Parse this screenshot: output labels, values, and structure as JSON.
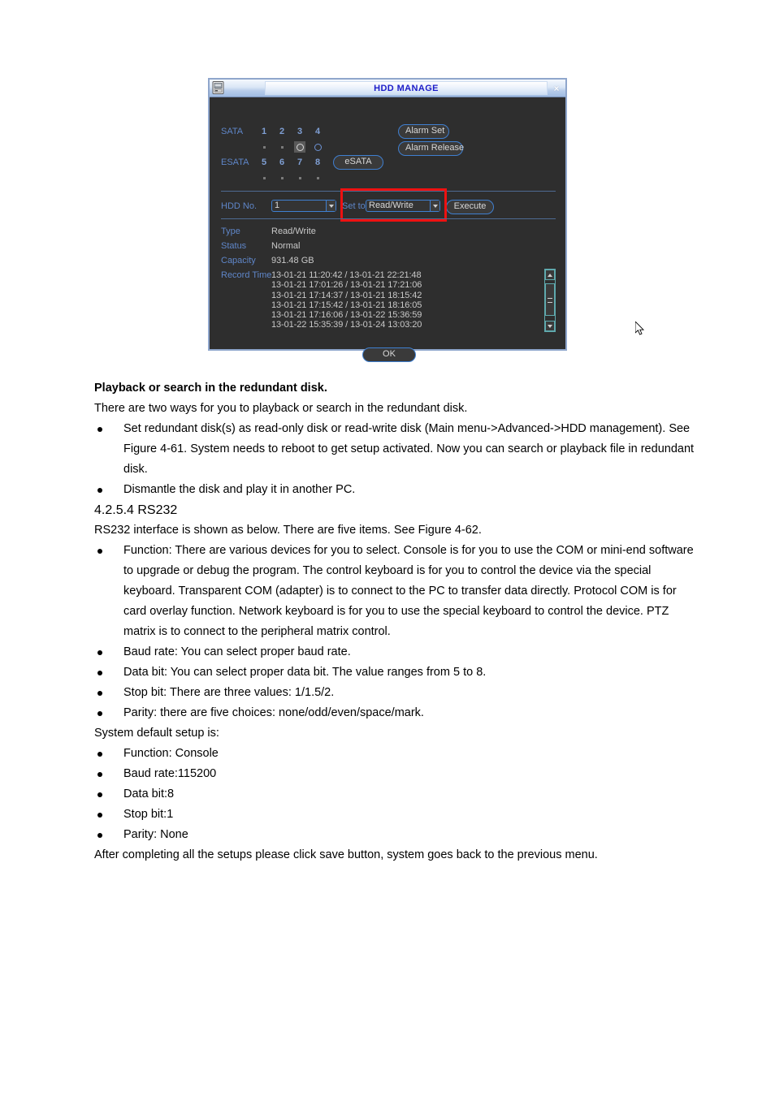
{
  "dialog": {
    "title": "HDD MANAGE",
    "icon": "hdd-icon",
    "close_label": "×",
    "sata": {
      "label": "SATA",
      "numbers": [
        "1",
        "2",
        "3",
        "4"
      ],
      "states": [
        "dot",
        "dot",
        "ring-selected",
        "ring"
      ]
    },
    "esata": {
      "label": "ESATA",
      "numbers": [
        "5",
        "6",
        "7",
        "8"
      ],
      "states": [
        "dot",
        "dot",
        "dot",
        "dot"
      ],
      "button_label": "eSATA"
    },
    "buttons": {
      "alarm_set": "Alarm Set",
      "alarm_release": "Alarm Release",
      "execute": "Execute",
      "ok": "OK"
    },
    "hdd_no": {
      "label": "HDD No.",
      "value": "1"
    },
    "set_to": {
      "label": "Set to",
      "value": "Read/Write"
    },
    "info": {
      "type_label": "Type",
      "type_value": "Read/Write",
      "status_label": "Status",
      "status_value": "Normal",
      "capacity_label": "Capacity",
      "capacity_value": "931.48 GB",
      "record_time_label": "Record Time"
    },
    "record_times": [
      "13-01-21 11:20:42 / 13-01-21 22:21:48",
      "13-01-21 17:01:26 / 13-01-21 17:21:06",
      "13-01-21 17:14:37 / 13-01-21 18:15:42",
      "13-01-21 17:15:42 / 13-01-21 18:16:05",
      "13-01-21 17:16:06 / 13-01-22 15:36:59",
      "13-01-22 15:35:39 / 13-01-24 13:03:20"
    ],
    "colors": {
      "background": "#2e2e2e",
      "border": "#8fa6cc",
      "label_blue": "#5f86c8",
      "value_gray": "#c9c9c9",
      "button_border": "#3f7fd0",
      "title_text": "#1c1cc8",
      "highlight_red": "#ee1111",
      "scrollbar_teal": "#5fa9ad"
    }
  },
  "document": {
    "section1_heading": "Playback or search in the redundant disk.",
    "section1_intro": "There are two ways for you to playback or search in the redundant disk.",
    "section1_bullets": [
      "Set redundant disk(s) as read-only disk or read-write disk (Main menu->Advanced->HDD management).  See Figure 4-61. System needs to reboot to get setup activated. Now you can search or playback file in redundant disk.",
      "Dismantle the disk and play it in another PC."
    ],
    "section2_heading": "4.2.5.4  RS232",
    "section2_intro": "RS232 interface is shown as below. There are five items. See Figure 4-62.",
    "section2_bullets": [
      "Function: There are various devices for you to select. Console is for you to use the COM or mini-end software to upgrade or debug the program. The control keyboard is for you to control the device via the special keyboard. Transparent COM (adapter) is to connect to the PC to transfer data directly. Protocol COM is for card overlay function. Network keyboard is for you to use the special keyboard to control the device. PTZ matrix is to connect to the peripheral matrix control.",
      "Baud rate: You can select proper baud rate.",
      "Data bit: You can select proper data bit. The value ranges from 5 to 8.",
      "Stop bit: There are three values: 1/1.5/2.",
      "Parity: there are five choices: none/odd/even/space/mark."
    ],
    "defaults_intro": "System default setup is:",
    "defaults_bullets": [
      "Function: Console",
      "Baud rate:115200",
      "Data bit:8",
      "Stop bit:1",
      "Parity: None"
    ],
    "closing": "After completing all the setups please click save button, system goes back to the previous menu."
  }
}
